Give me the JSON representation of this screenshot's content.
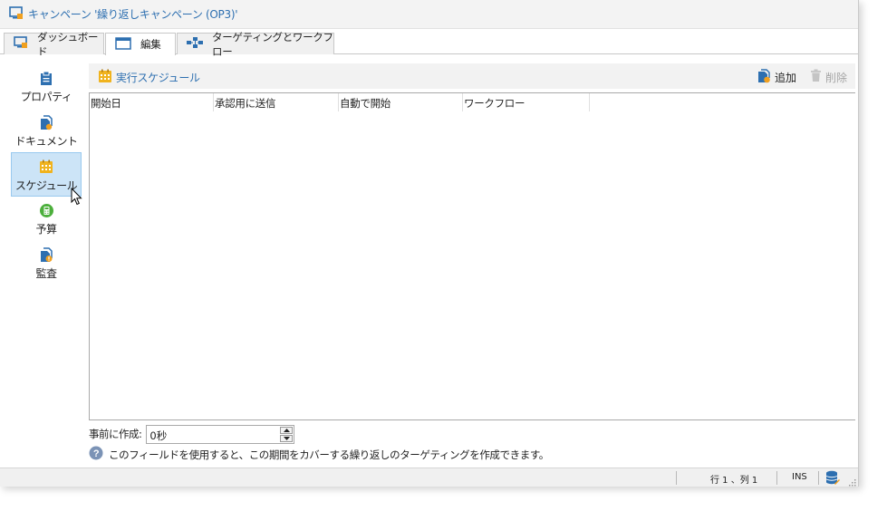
{
  "window": {
    "title": "キャンペーン '繰り返しキャンペーン (OP3)'"
  },
  "tabs": [
    {
      "label": "ダッシュボード",
      "icon": "dashboard-icon"
    },
    {
      "label": "編集",
      "icon": "edit-form-icon",
      "active": true
    },
    {
      "label": "ターゲティングとワークフロー",
      "icon": "workflow-icon"
    }
  ],
  "sidebar": {
    "items": [
      {
        "label": "プロパティ",
        "icon": "clipboard-icon"
      },
      {
        "label": "ドキュメント",
        "icon": "documents-icon"
      },
      {
        "label": "スケジュール",
        "icon": "calendar-icon",
        "selected": true
      },
      {
        "label": "予算",
        "icon": "budget-icon"
      },
      {
        "label": "監査",
        "icon": "audit-icon"
      }
    ]
  },
  "toolbar": {
    "title": "実行スケジュール",
    "add_label": "追加",
    "delete_label": "削除"
  },
  "grid": {
    "columns": [
      "開始日",
      "承認用に送信",
      "自動で開始",
      "ワークフロー"
    ],
    "rows": []
  },
  "form": {
    "create_before_label": "事前に作成:",
    "create_before_value": "0秒"
  },
  "hint": {
    "text": "このフィールドを使用すると、この期間をカバーする繰り返しのターゲティングを作成できます。"
  },
  "status": {
    "position": "行 1 、列 1",
    "mode": "INS"
  },
  "colors": {
    "accent_blue": "#2d6fb0",
    "selected_bg": "#cce4f7",
    "calendar_yellow": "#f0b31e"
  }
}
